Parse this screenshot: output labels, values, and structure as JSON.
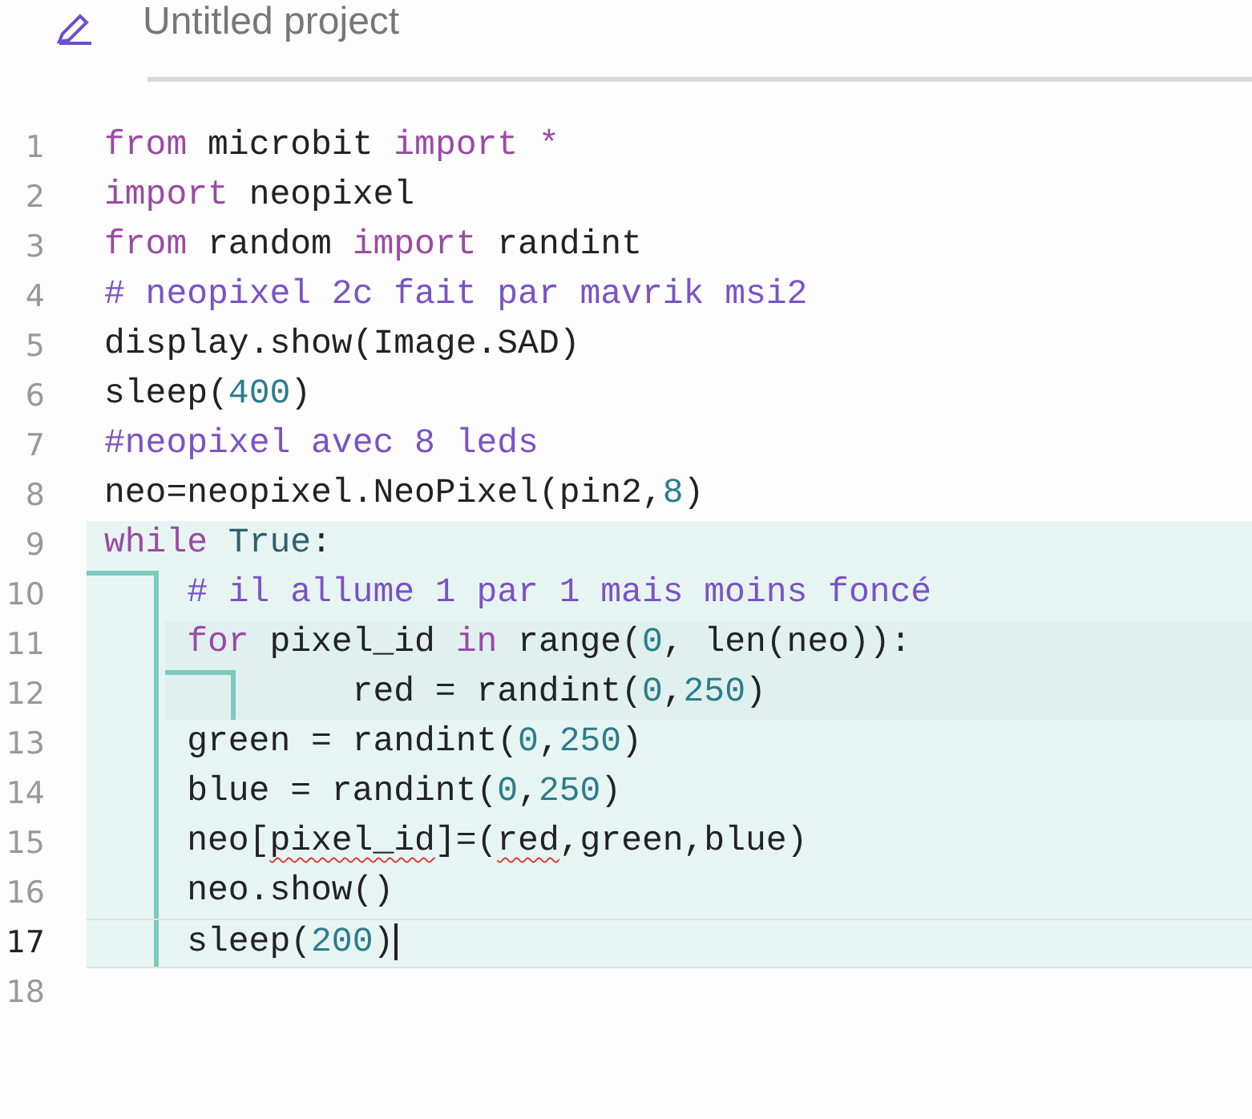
{
  "project": {
    "title": "Untitled project"
  },
  "editor": {
    "lines": [
      {
        "number": "1",
        "current": false,
        "tokens": [
          {
            "text": "from",
            "kind": "keyword"
          },
          {
            "text": " microbit ",
            "kind": "plain"
          },
          {
            "text": "import",
            "kind": "keyword"
          },
          {
            "text": " *",
            "kind": "keyword"
          }
        ]
      },
      {
        "number": "2",
        "current": false,
        "tokens": [
          {
            "text": "import",
            "kind": "keyword"
          },
          {
            "text": " neopixel",
            "kind": "plain"
          }
        ]
      },
      {
        "number": "3",
        "current": false,
        "tokens": [
          {
            "text": "from",
            "kind": "keyword"
          },
          {
            "text": " random ",
            "kind": "plain"
          },
          {
            "text": "import",
            "kind": "keyword"
          },
          {
            "text": " randint",
            "kind": "plain"
          }
        ]
      },
      {
        "number": "4",
        "current": false,
        "tokens": [
          {
            "text": "# neopixel 2c fait par mavrik msi2",
            "kind": "comment"
          }
        ]
      },
      {
        "number": "5",
        "current": false,
        "tokens": [
          {
            "text": "display.show(Image.SAD)",
            "kind": "plain"
          }
        ]
      },
      {
        "number": "6",
        "current": false,
        "tokens": [
          {
            "text": "sleep(",
            "kind": "plain"
          },
          {
            "text": "400",
            "kind": "number"
          },
          {
            "text": ")",
            "kind": "plain"
          }
        ]
      },
      {
        "number": "7",
        "current": false,
        "tokens": [
          {
            "text": "#neopixel avec 8 leds",
            "kind": "comment"
          }
        ]
      },
      {
        "number": "8",
        "current": false,
        "tokens": [
          {
            "text": "neo=neopixel.NeoPixel(pin2,",
            "kind": "plain"
          },
          {
            "text": "8",
            "kind": "number"
          },
          {
            "text": ")",
            "kind": "plain"
          }
        ]
      },
      {
        "number": "9",
        "current": false,
        "tokens": [
          {
            "text": "while",
            "kind": "keyword"
          },
          {
            "text": " True",
            "kind": "constant"
          },
          {
            "text": ":",
            "kind": "plain"
          }
        ],
        "children": [
          {
            "number": "10",
            "current": false,
            "tokens": [
              {
                "text": "# il allume 1 par 1 mais moins foncé",
                "kind": "comment"
              }
            ]
          },
          {
            "number": "11",
            "current": false,
            "tokens": [
              {
                "text": "for",
                "kind": "keyword"
              },
              {
                "text": " pixel_id ",
                "kind": "plain"
              },
              {
                "text": "in",
                "kind": "keyword"
              },
              {
                "text": " range(",
                "kind": "plain"
              },
              {
                "text": "0",
                "kind": "number"
              },
              {
                "text": ", len(neo)):",
                "kind": "plain"
              }
            ],
            "children": [
              {
                "number": "12",
                "current": false,
                "tokens": [
                  {
                    "text": "    red = randint(",
                    "kind": "plain"
                  },
                  {
                    "text": "0",
                    "kind": "number"
                  },
                  {
                    "text": ",",
                    "kind": "plain"
                  },
                  {
                    "text": "250",
                    "kind": "number"
                  },
                  {
                    "text": ")",
                    "kind": "plain"
                  }
                ]
              }
            ]
          },
          {
            "number": "13",
            "current": false,
            "tokens": [
              {
                "text": "green = randint(",
                "kind": "plain"
              },
              {
                "text": "0",
                "kind": "number"
              },
              {
                "text": ",",
                "kind": "plain"
              },
              {
                "text": "250",
                "kind": "number"
              },
              {
                "text": ")",
                "kind": "plain"
              }
            ]
          },
          {
            "number": "14",
            "current": false,
            "tokens": [
              {
                "text": "blue = randint(",
                "kind": "plain"
              },
              {
                "text": "0",
                "kind": "number"
              },
              {
                "text": ",",
                "kind": "plain"
              },
              {
                "text": "250",
                "kind": "number"
              },
              {
                "text": ")",
                "kind": "plain"
              }
            ]
          },
          {
            "number": "15",
            "current": false,
            "tokens": [
              {
                "text": "neo[",
                "kind": "plain"
              },
              {
                "text": "pixel_id",
                "kind": "error"
              },
              {
                "text": "]=(",
                "kind": "plain"
              },
              {
                "text": "red",
                "kind": "error"
              },
              {
                "text": ",green,blue)",
                "kind": "plain"
              }
            ]
          },
          {
            "number": "16",
            "current": false,
            "tokens": [
              {
                "text": "neo.show()",
                "kind": "plain"
              }
            ]
          },
          {
            "number": "17",
            "current": true,
            "tokens": [
              {
                "text": "sleep(",
                "kind": "plain"
              },
              {
                "text": "200",
                "kind": "number"
              },
              {
                "text": ")",
                "kind": "plain"
              }
            ]
          }
        ]
      },
      {
        "number": "18",
        "current": false
      }
    ]
  }
}
